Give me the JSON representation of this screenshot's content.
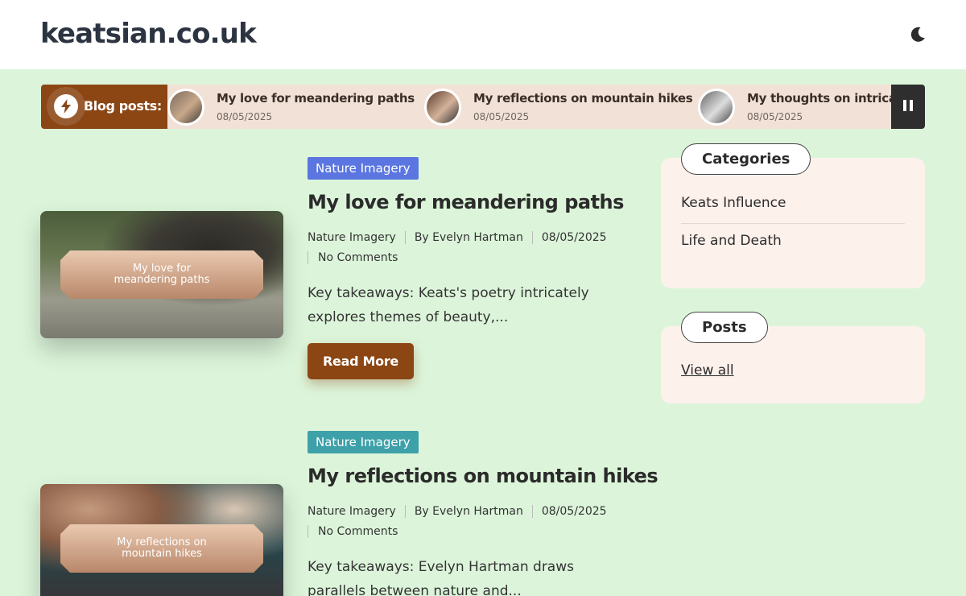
{
  "site": {
    "title": "keatsian.co.uk"
  },
  "header": {
    "theme_toggle_icon": "moon-icon"
  },
  "ticker": {
    "label": "Blog posts:",
    "icon": "lightning-icon",
    "pause_icon": "pause-icon",
    "items": [
      {
        "title": "My love for meandering paths",
        "date": "08/05/2025"
      },
      {
        "title": "My reflections on mountain hikes",
        "date": "08/05/2025"
      },
      {
        "title": "My thoughts on intricat",
        "date": "08/05/2025"
      }
    ]
  },
  "posts": [
    {
      "category": "Nature Imagery",
      "badge_color": "#5b76e0",
      "image_caption": "My love for meandering paths",
      "title": "My love for meandering paths",
      "meta_category": "Nature Imagery",
      "author": "By Evelyn Hartman",
      "date": "08/05/2025",
      "comments": "No Comments",
      "excerpt": "Key takeaways: Keats's poetry intricately explores themes of beauty,...",
      "read_more": "Read More"
    },
    {
      "category": "Nature Imagery",
      "badge_color": "#3ea0a8",
      "image_caption": "My reflections on mountain hikes",
      "title": "My reflections on mountain hikes",
      "meta_category": "Nature Imagery",
      "author": "By Evelyn Hartman",
      "date": "08/05/2025",
      "comments": "No Comments",
      "excerpt": "Key takeaways: Evelyn Hartman draws parallels between nature and..."
    }
  ],
  "sidebar": {
    "categories": {
      "title": "Categories",
      "items": [
        "Keats Influence",
        "Life and Death"
      ]
    },
    "posts": {
      "title": "Posts",
      "view_all": "View all"
    }
  },
  "colors": {
    "page_bg": "#dcf5da",
    "accent_brown": "#8b4614",
    "ticker_bg": "#f2e1d6",
    "widget_bg": "#fdf1ec"
  }
}
